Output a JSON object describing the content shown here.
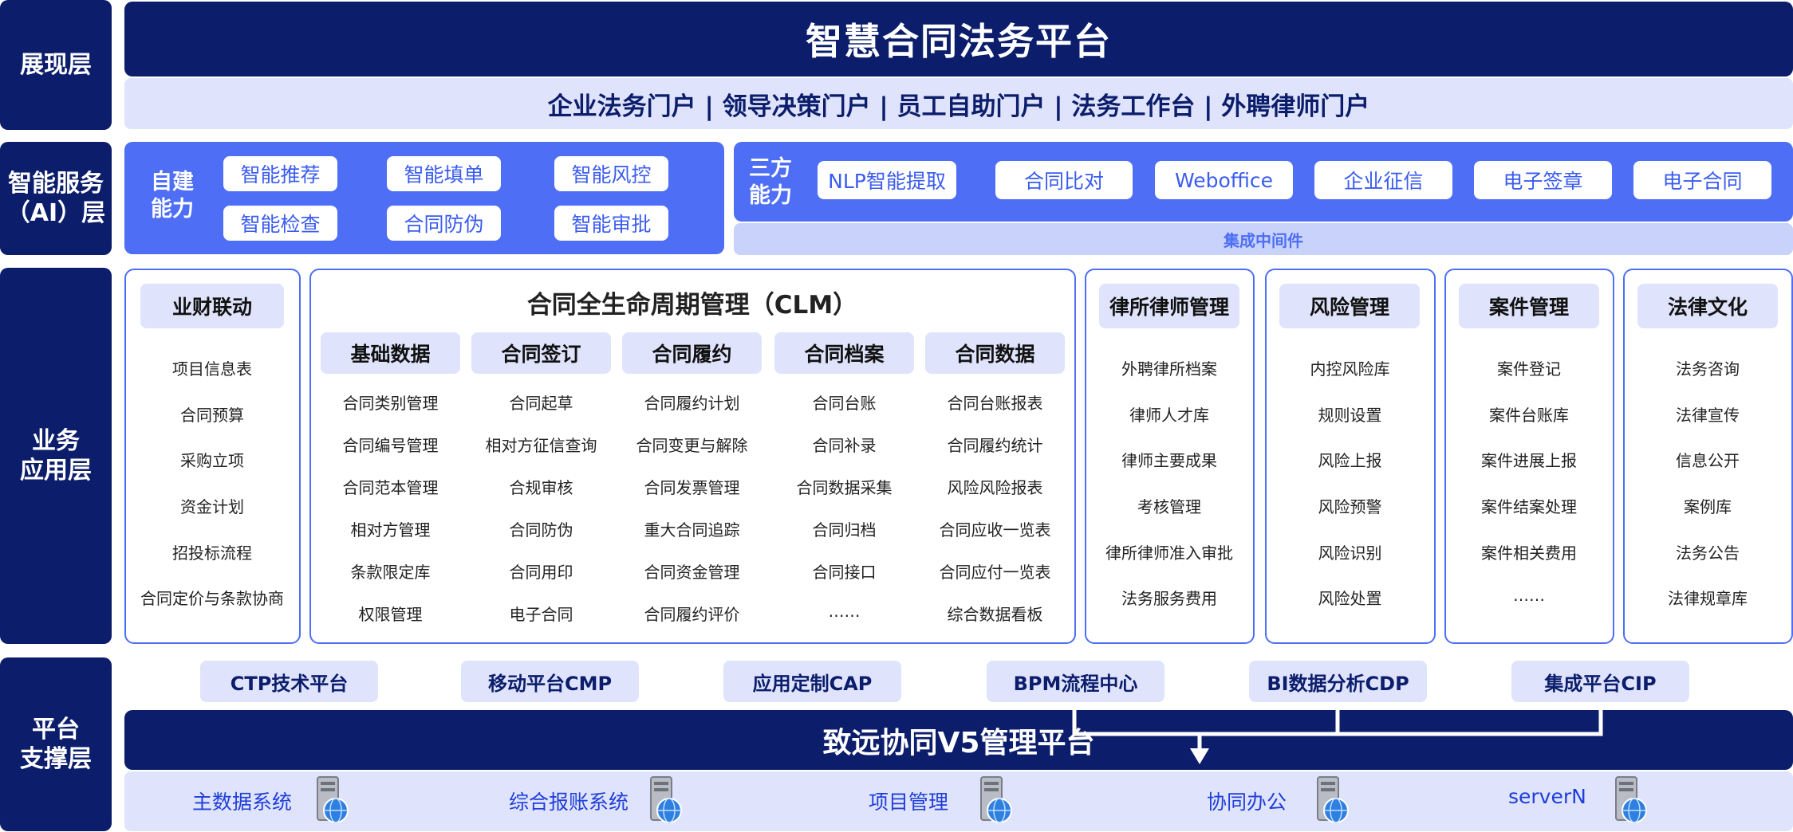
{
  "layers": {
    "presentation": "展现层",
    "ai": "智能服务\n（AI）层",
    "business": "业务\n应用层",
    "platform": "平台\n支撑层"
  },
  "presentation": {
    "title": "智慧合同法务平台",
    "portals": "企业法务门户 | 领导决策门户 | 员工自助门户 | 法务工作台 | 外聘律师门户"
  },
  "ai": {
    "self_label": "自建\n能力",
    "self_items": [
      "智能推荐",
      "智能填单",
      "智能风控",
      "智能检查",
      "合同防伪",
      "智能审批"
    ],
    "third_label": "三方\n能力",
    "third_items": [
      "NLP智能提取",
      "合同比对",
      "Weboffice",
      "企业征信",
      "电子签章",
      "电子合同"
    ],
    "middleware": "集成中间件"
  },
  "business": {
    "yecai": {
      "title": "业财联动",
      "items": [
        "项目信息表",
        "合同预算",
        "采购立项",
        "资金计划",
        "招投标流程",
        "合同定价与条款协商"
      ]
    },
    "clm": {
      "title": "合同全生命周期管理（CLM）",
      "columns": [
        {
          "title": "基础数据",
          "items": [
            "合同类别管理",
            "合同编号管理",
            "合同范本管理",
            "相对方管理",
            "条款限定库",
            "权限管理"
          ]
        },
        {
          "title": "合同签订",
          "items": [
            "合同起草",
            "相对方征信查询",
            "合规审核",
            "合同防伪",
            "合同用印",
            "电子合同"
          ]
        },
        {
          "title": "合同履约",
          "items": [
            "合同履约计划",
            "合同变更与解除",
            "合同发票管理",
            "重大合同追踪",
            "合同资金管理",
            "合同履约评价"
          ]
        },
        {
          "title": "合同档案",
          "items": [
            "合同台账",
            "合同补录",
            "合同数据采集",
            "合同归档",
            "合同接口",
            "……"
          ]
        },
        {
          "title": "合同数据",
          "items": [
            "合同台账报表",
            "合同履约统计",
            "风险风险报表",
            "合同应收一览表",
            "合同应付一览表",
            "综合数据看板"
          ]
        }
      ]
    },
    "modules": [
      {
        "title": "律所律师管理",
        "items": [
          "外聘律所档案",
          "律师人才库",
          "律师主要成果",
          "考核管理",
          "律所律师准入审批",
          "法务服务费用"
        ]
      },
      {
        "title": "风险管理",
        "items": [
          "内控风险库",
          "规则设置",
          "风险上报",
          "风险预警",
          "风险识别",
          "风险处置"
        ]
      },
      {
        "title": "案件管理",
        "items": [
          "案件登记",
          "案件台账库",
          "案件进展上报",
          "案件结案处理",
          "案件相关费用",
          "……"
        ]
      },
      {
        "title": "法律文化",
        "items": [
          "法务咨询",
          "法律宣传",
          "信息公开",
          "案例库",
          "法务公告",
          "法律规章库"
        ]
      }
    ]
  },
  "platform": {
    "chips": [
      "CTP技术平台",
      "移动平台CMP",
      "应用定制CAP",
      "BPM流程中心",
      "BI数据分析CDP",
      "集成平台CIP"
    ],
    "main": "致远协同V5管理平台",
    "systems": [
      "主数据系统",
      "综合报账系统",
      "项目管理",
      "协同办公",
      "serverN"
    ]
  },
  "icons": {
    "server": "server-globe-icon"
  },
  "colors": {
    "navy": "#0b1d6b",
    "accent_blue": "#4d6ef5",
    "light_lavender": "#dfe3fb"
  }
}
